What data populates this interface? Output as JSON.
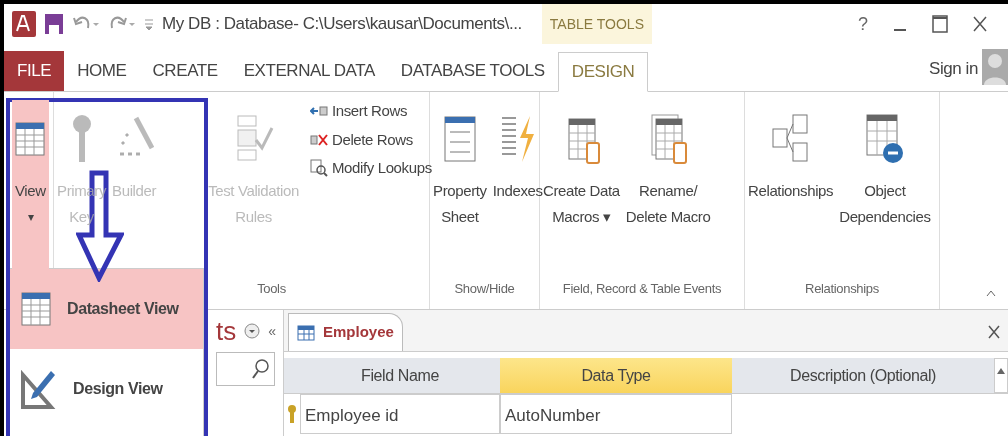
{
  "title_bar": {
    "title": "My DB : Database- C:\\Users\\kausar\\Documents\\...",
    "context_label": "TABLE TOOLS",
    "help": "?"
  },
  "tabs": [
    {
      "label": "FILE",
      "kind": "file",
      "selected": false
    },
    {
      "label": "HOME",
      "kind": "tab",
      "selected": false
    },
    {
      "label": "CREATE",
      "kind": "tab",
      "selected": false
    },
    {
      "label": "EXTERNAL DATA",
      "kind": "tab",
      "selected": false
    },
    {
      "label": "DATABASE TOOLS",
      "kind": "tab",
      "selected": false
    },
    {
      "label": "DESIGN",
      "kind": "tab",
      "selected": true
    }
  ],
  "sign_in": "Sign in",
  "ribbon": {
    "groups": [
      {
        "buttons": [
          {
            "kind": "large",
            "lines": [
              "View"
            ],
            "caret": "▾",
            "pressed": true,
            "disabled": false
          }
        ]
      },
      {
        "label": "Tools",
        "buttons": [
          {
            "kind": "large",
            "lines": [
              "Primary",
              "Key"
            ],
            "pressed": false,
            "disabled": true
          },
          {
            "kind": "large",
            "lines": [
              "Builder"
            ],
            "pressed": false,
            "disabled": true
          },
          {
            "kind": "large",
            "lines": [
              "Test Validation",
              "Rules"
            ],
            "pressed": false,
            "disabled": true
          },
          {
            "kind": "small",
            "lines": [
              "Insert Rows"
            ],
            "pressed": false,
            "disabled": false
          },
          {
            "kind": "small",
            "lines": [
              "Delete Rows"
            ],
            "pressed": false,
            "disabled": false
          },
          {
            "kind": "small",
            "lines": [
              "Modify Lookups"
            ],
            "pressed": false,
            "disabled": false
          }
        ]
      },
      {
        "label": "Show/Hide",
        "buttons": [
          {
            "kind": "large",
            "lines": [
              "Property",
              "Sheet"
            ],
            "pressed": false,
            "disabled": false
          },
          {
            "kind": "large",
            "lines": [
              "Indexes"
            ],
            "pressed": false,
            "disabled": false
          }
        ]
      },
      {
        "label": "Field, Record & Table Events",
        "buttons": [
          {
            "kind": "large",
            "lines": [
              "Create Data",
              "Macros"
            ],
            "caret": "▾",
            "pressed": false,
            "disabled": false
          },
          {
            "kind": "large",
            "lines": [
              "Rename/",
              "Delete Macro"
            ],
            "pressed": false,
            "disabled": false
          }
        ]
      },
      {
        "label": "Relationships",
        "buttons": [
          {
            "kind": "large",
            "lines": [
              "Relationships"
            ],
            "pressed": false,
            "disabled": false
          },
          {
            "kind": "large",
            "lines": [
              "Object",
              "Dependencies"
            ],
            "pressed": false,
            "disabled": false
          }
        ]
      }
    ]
  },
  "view_menu": {
    "items": [
      {
        "label": "Datasheet View",
        "selected": true
      },
      {
        "label": "Design View",
        "selected": false
      }
    ]
  },
  "nav_pane": {
    "title_fragment": "ts",
    "collapse": "«"
  },
  "document": {
    "tab": "Employee",
    "columns": [
      {
        "label": "Field Name",
        "selected": false
      },
      {
        "label": "Data Type",
        "selected": true
      },
      {
        "label": "Description (Optional)",
        "selected": false
      }
    ],
    "rows": [
      {
        "primary_key": true,
        "cells": [
          "Employee id",
          "AutoNumber"
        ]
      }
    ]
  }
}
